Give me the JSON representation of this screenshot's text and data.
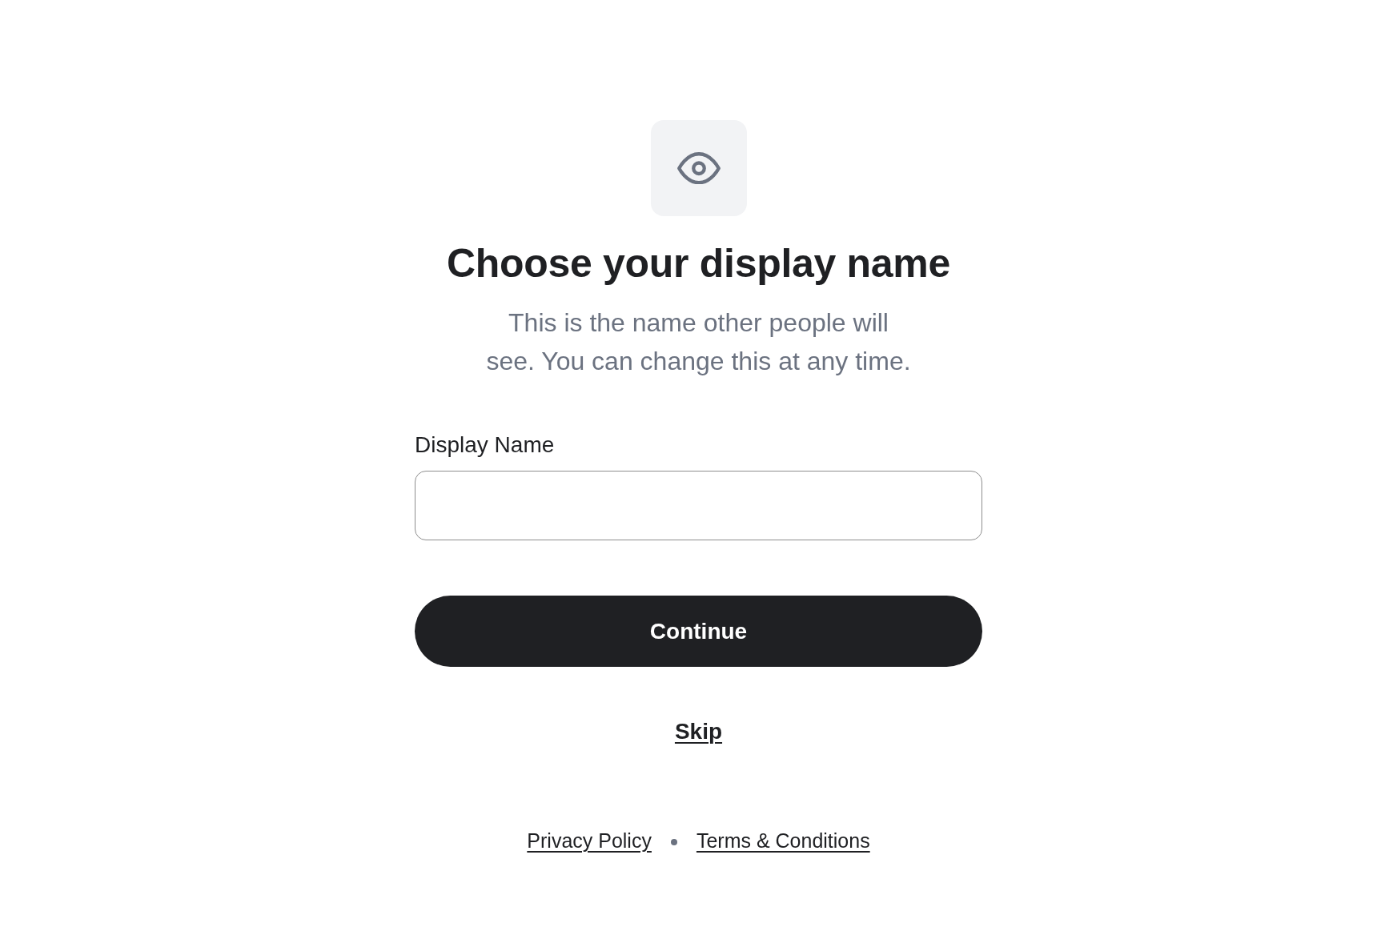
{
  "heading": "Choose your display name",
  "subtitle": "This is the name other people will see. You can change this at any time.",
  "form": {
    "label": "Display Name"
  },
  "primary_button": "Continue",
  "skip_link": "Skip",
  "footer_links": [
    "Privacy Policy",
    "Terms & Conditions"
  ]
}
